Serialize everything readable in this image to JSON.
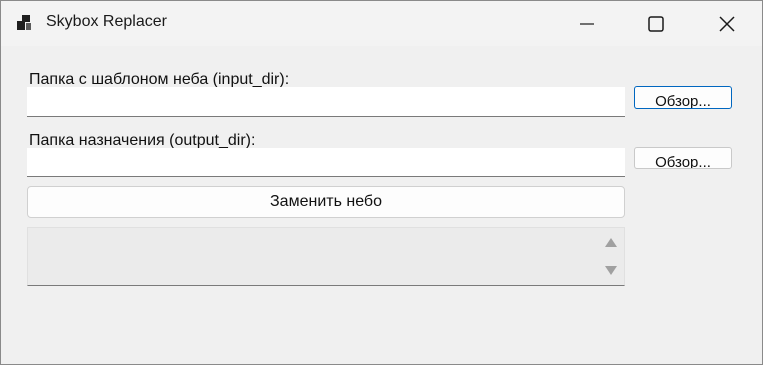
{
  "window": {
    "title": "Skybox Replacer"
  },
  "form": {
    "input_label": "Папка с шаблоном неба (input_dir):",
    "input_value": "",
    "input_browse": "Обзор...",
    "output_label": "Папка назначения (output_dir):",
    "output_value": "",
    "output_browse": "Обзор...",
    "replace_button": "Заменить небо",
    "log_text": ""
  },
  "colors": {
    "window_bg": "#f0f0f0",
    "focus_accent": "#0067c0"
  }
}
